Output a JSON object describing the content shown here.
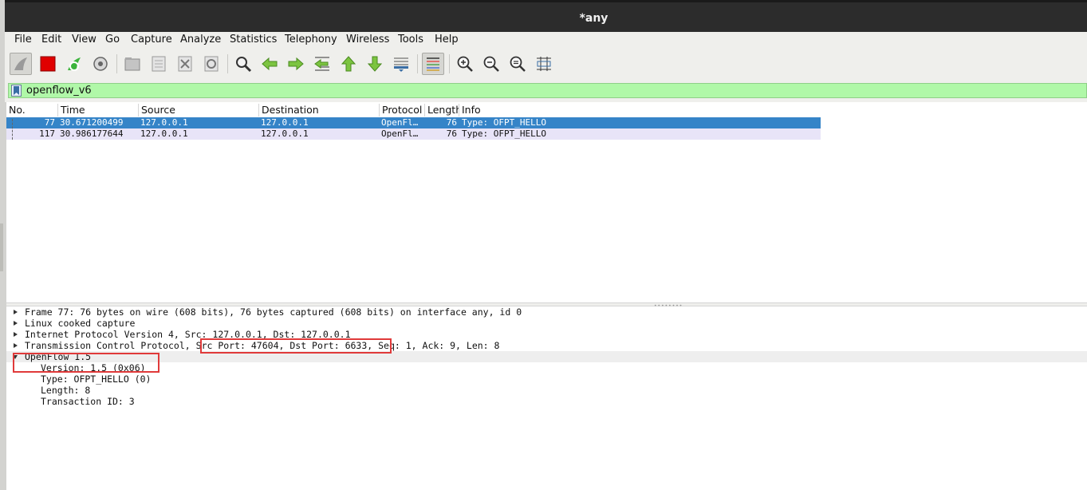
{
  "window": {
    "title": "*any"
  },
  "menu": [
    "File",
    "Edit",
    "View",
    "Go",
    "Capture",
    "Analyze",
    "Statistics",
    "Telephony",
    "Wireless",
    "Tools",
    "Help"
  ],
  "toolbar": {
    "icons": [
      "shark-fin-start-icon",
      "stop-capture-icon",
      "restart-capture-icon",
      "capture-options-icon",
      "open-file-icon",
      "save-file-icon",
      "close-file-icon",
      "reload-file-icon",
      "find-packet-icon",
      "go-back-icon",
      "go-forward-icon",
      "go-to-packet-icon",
      "first-packet-icon",
      "last-packet-icon",
      "auto-scroll-icon",
      "colorize-icon",
      "zoom-in-icon",
      "zoom-out-icon",
      "normal-size-icon",
      "resize-columns-icon"
    ]
  },
  "filter": {
    "value": "openflow_v6"
  },
  "packet_list": {
    "columns": [
      "No.",
      "Time",
      "Source",
      "Destination",
      "Protocol",
      "Length",
      "Info"
    ],
    "rows": [
      {
        "no": "77",
        "time": "30.671200499",
        "source": "127.0.0.1",
        "destination": "127.0.0.1",
        "protocol": "OpenFl…",
        "length": "76",
        "info": "Type: OFPT_HELLO",
        "selected": true
      },
      {
        "no": "117",
        "time": "30.986177644",
        "source": "127.0.0.1",
        "destination": "127.0.0.1",
        "protocol": "OpenFl…",
        "length": "76",
        "info": "Type: OFPT_HELLO",
        "selected": false
      }
    ]
  },
  "details": {
    "frame": "Frame 77: 76 bytes on wire (608 bits), 76 bytes captured (608 bits) on interface any, id 0",
    "linux": "Linux cooked capture",
    "ip": "Internet Protocol Version 4, Src: 127.0.0.1, Dst: 127.0.0.1",
    "tcp_prefix": "Transmission Control Protocol, ",
    "tcp_ports": "Src Port: 47604, Dst Port: 6633,",
    "tcp_suffix": " Seq: 1, Ack: 9, Len: 8",
    "openflow": "OpenFlow 1.5",
    "version": "Version: 1.5 (0x06)",
    "type": "Type: OFPT_HELLO (0)",
    "length": "Length: 8",
    "xid": "Transaction ID: 3"
  },
  "colors": {
    "selected_row": "#3584c8",
    "alt_row": "#e8e4f8",
    "filter_bg": "#b0f8a8",
    "annotation": "#e03a3a"
  }
}
